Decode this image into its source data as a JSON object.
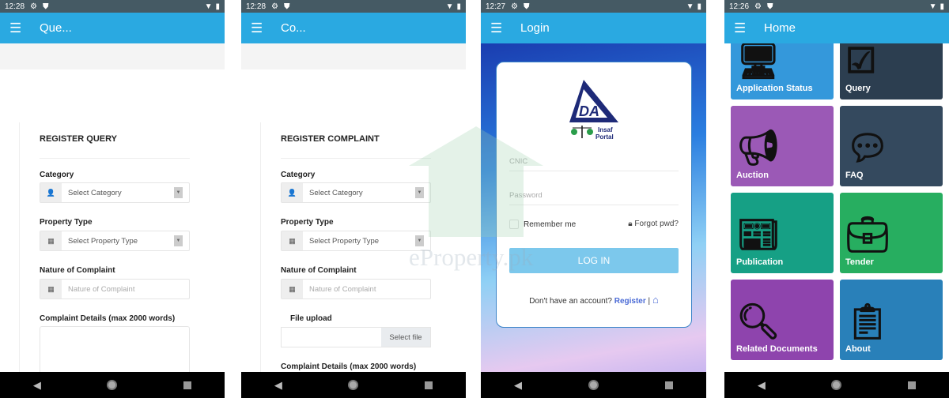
{
  "screens": [
    {
      "status": {
        "time": "12:28"
      },
      "appbar": {
        "title": "Que..."
      },
      "form": {
        "title": "REGISTER QUERY",
        "category_label": "Category",
        "category_value": "Select Category",
        "property_label": "Property Type",
        "property_value": "Select Property Type",
        "nature_label": "Nature of Complaint",
        "nature_placeholder": "Nature of Complaint",
        "details_label": "Complaint Details (max 2000 words)"
      }
    },
    {
      "status": {
        "time": "12:28"
      },
      "appbar": {
        "title": "Co..."
      },
      "form": {
        "title": "REGISTER COMPLAINT",
        "category_label": "Category",
        "category_value": "Select Category",
        "property_label": "Property Type",
        "property_value": "Select Property Type",
        "nature_label": "Nature of Complaint",
        "nature_placeholder": "Nature of Complaint",
        "file_label": "File upload",
        "file_button": "Select file",
        "details_label": "Complaint Details (max 2000 words)"
      }
    },
    {
      "status": {
        "time": "12:27"
      },
      "appbar": {
        "title": "Login"
      },
      "login": {
        "logo_text": "CDA Insaf Portal",
        "cnic_placeholder": "CNIC",
        "password_placeholder": "Password",
        "remember": "Remember me",
        "forgot": "Forgot pwd?",
        "login_button": "LOG IN",
        "no_account": "Don't have an account?",
        "register": "Register",
        "separator": "|"
      }
    },
    {
      "status": {
        "time": "12:26"
      },
      "appbar": {
        "title": "Home"
      },
      "tiles": [
        {
          "label": "Application Status",
          "color": "#3498db",
          "icon": "monitor-icon"
        },
        {
          "label": "Query",
          "color": "#2c3e50",
          "icon": "checklist-icon"
        },
        {
          "label": "Auction",
          "color": "#9b59b6",
          "icon": "megaphone-icon"
        },
        {
          "label": "FAQ",
          "color": "#34495e",
          "icon": "chat-icon"
        },
        {
          "label": "Publication",
          "color": "#16a085",
          "icon": "newspaper-icon"
        },
        {
          "label": "Tender",
          "color": "#27ae60",
          "icon": "briefcase-icon"
        },
        {
          "label": "Related Documents",
          "color": "#8e44ad",
          "icon": "magnifier-icon"
        },
        {
          "label": "About",
          "color": "#2980b9",
          "icon": "clipboard-icon"
        }
      ]
    }
  ],
  "watermark": "eProperty.pk",
  "colors": {
    "appbar": "#2aa9e1",
    "status": "#455a64",
    "login_button": "#7cc8ec"
  }
}
